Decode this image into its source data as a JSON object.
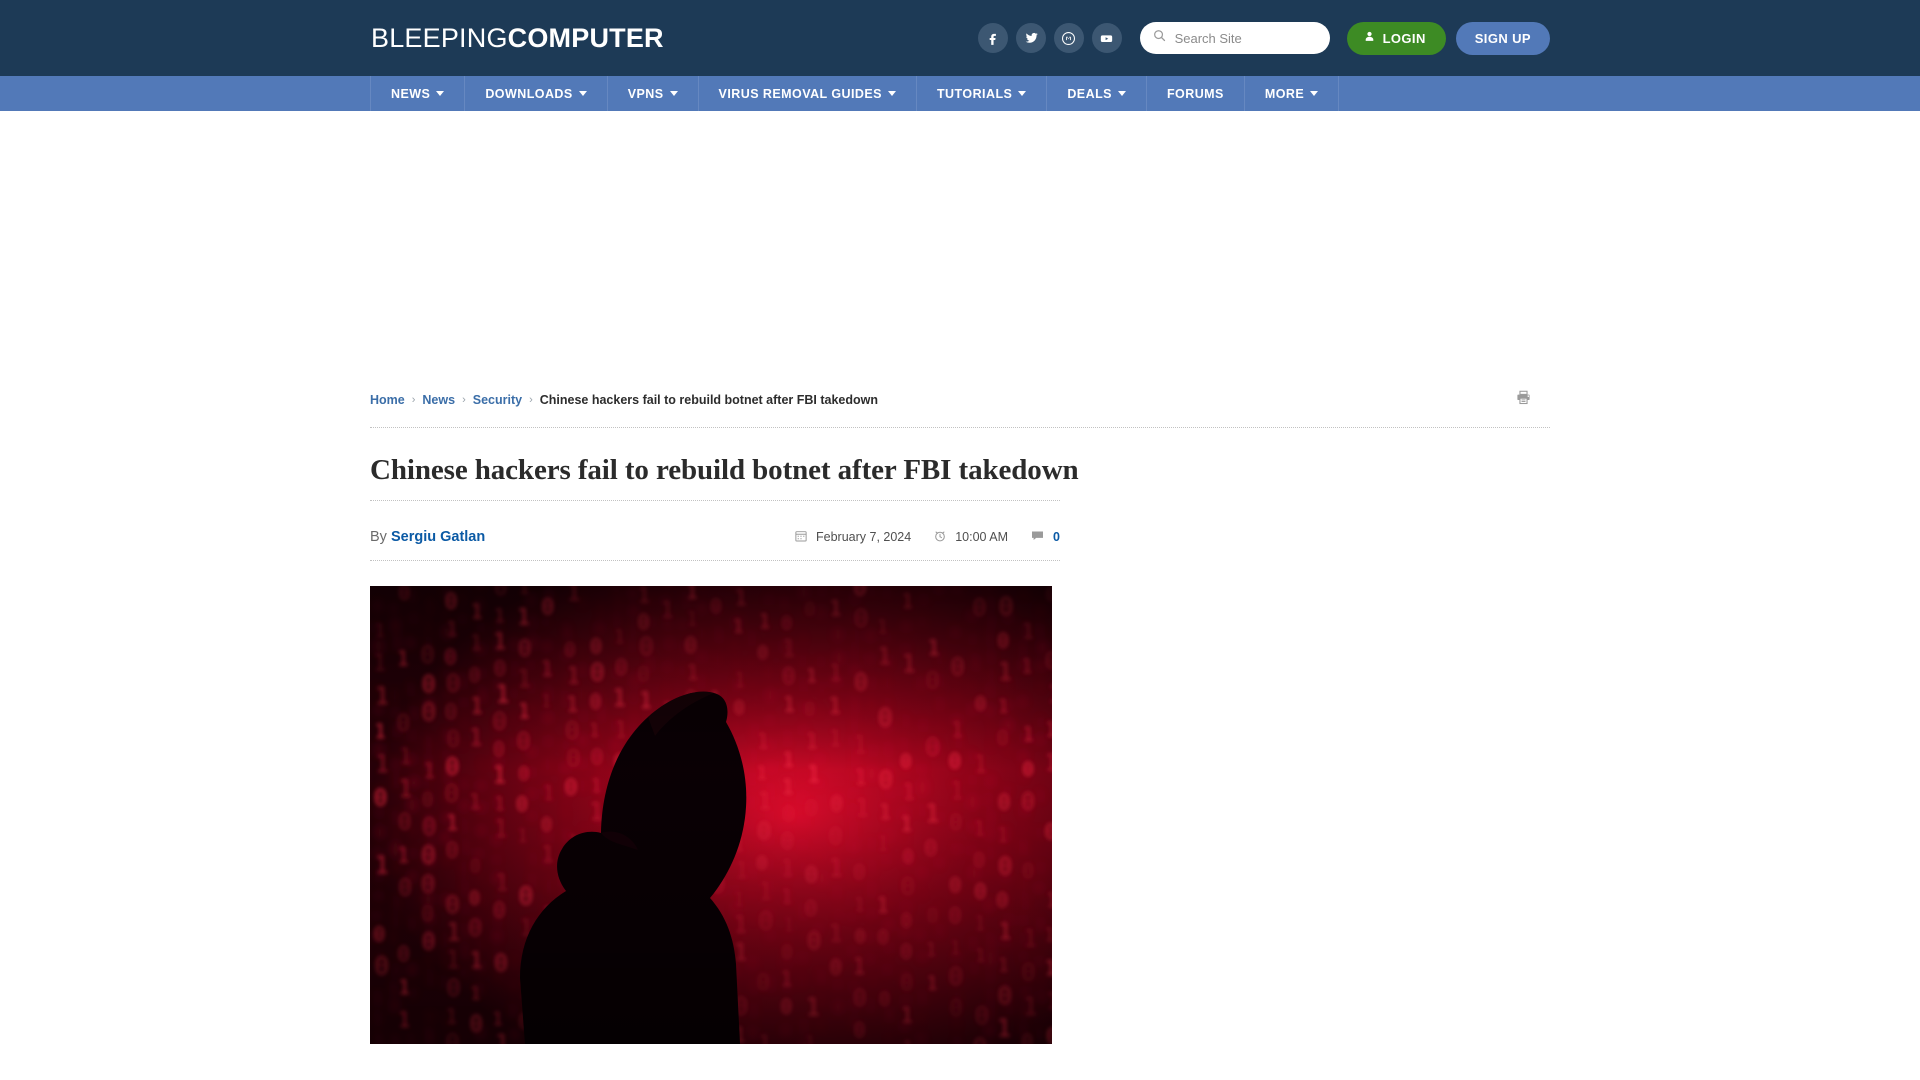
{
  "site": {
    "logo_light": "BLEEPING",
    "logo_bold": "COMPUTER"
  },
  "header": {
    "socials": [
      {
        "name": "facebook-icon",
        "label": "Facebook"
      },
      {
        "name": "twitter-icon",
        "label": "Twitter"
      },
      {
        "name": "mastodon-icon",
        "label": "Mastodon"
      },
      {
        "name": "youtube-icon",
        "label": "YouTube"
      }
    ],
    "search": {
      "placeholder": "Search Site",
      "value": "",
      "icon": "search-icon"
    },
    "login_label": "LOGIN",
    "signup_label": "SIGN UP",
    "login_color": "#3d8b24",
    "signup_color": "#5279b8",
    "background_color": "#1d3a56"
  },
  "nav": {
    "background_color": "#5279b8",
    "items": [
      {
        "label": "NEWS",
        "has_dropdown": true
      },
      {
        "label": "DOWNLOADS",
        "has_dropdown": true
      },
      {
        "label": "VPNS",
        "has_dropdown": true
      },
      {
        "label": "VIRUS REMOVAL GUIDES",
        "has_dropdown": true
      },
      {
        "label": "TUTORIALS",
        "has_dropdown": true
      },
      {
        "label": "DEALS",
        "has_dropdown": true
      },
      {
        "label": "FORUMS",
        "has_dropdown": false
      },
      {
        "label": "MORE",
        "has_dropdown": true
      }
    ]
  },
  "breadcrumb": {
    "items": [
      {
        "label": "Home",
        "link": true
      },
      {
        "label": "News",
        "link": true
      },
      {
        "label": "Security",
        "link": true
      },
      {
        "label": "Chinese hackers fail to rebuild botnet after FBI takedown",
        "link": false
      }
    ],
    "separator": "›",
    "print_icon": "print-icon"
  },
  "article": {
    "title": "Chinese hackers fail to rebuild botnet after FBI takedown",
    "byline_prefix": "By",
    "author": "Sergiu Gatlan",
    "date": "February 7, 2024",
    "time": "10:00 AM",
    "comment_count": "0",
    "date_icon": "calendar-icon",
    "time_icon": "alarm-clock-icon",
    "comment_icon": "comment-bubble-icon",
    "hero_image": {
      "name": "hero-image-hooded-hacker",
      "description": "Hooded figure silhouette in front of falling red binary code",
      "accent_color": "#e00a2a",
      "background_color": "#140008"
    }
  }
}
